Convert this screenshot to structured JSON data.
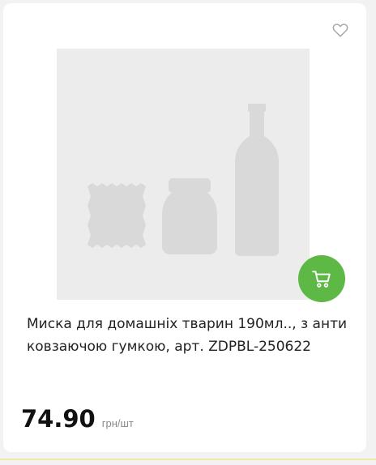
{
  "product": {
    "title": "Миска для домашніх тварин 190мл.., з антиковзаючою гумкою, арт. ZDPBL-250622",
    "price": "74.90",
    "unit": "грн/шт"
  },
  "icons": {
    "favorite": "heart-icon",
    "cart": "cart-icon",
    "placeholder": "product-placeholder-icon"
  },
  "colors": {
    "accent": "#5db846",
    "card": "#ffffff",
    "placeholder": "#ececec",
    "placeholder_shapes": "#d9d9d9"
  }
}
